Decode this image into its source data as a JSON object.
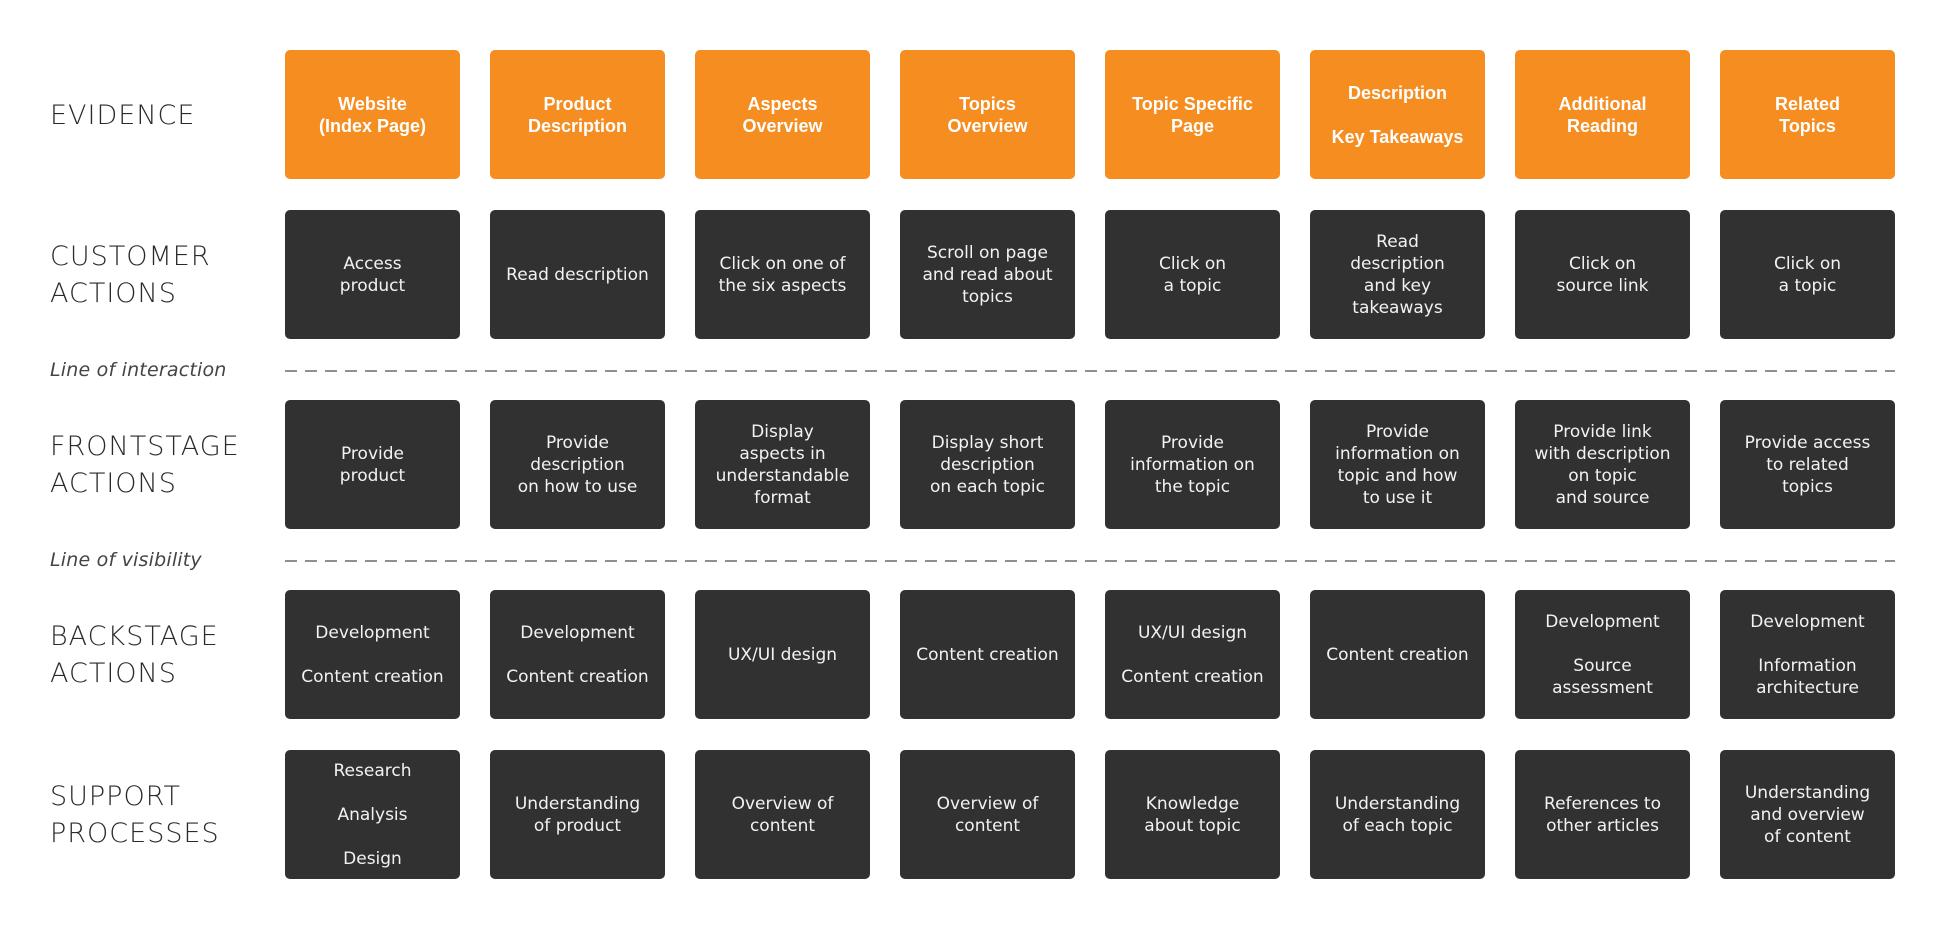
{
  "colors": {
    "evidence_bg": "#f58d21",
    "action_bg": "#313131",
    "line": "#8f8f8f",
    "text_light": "#f2f2f2"
  },
  "rows": [
    {
      "key": "evidence",
      "label": [
        "EVIDENCE"
      ]
    },
    {
      "key": "customer",
      "label": [
        "CUSTOMER",
        "ACTIONS"
      ]
    },
    {
      "key": "frontstage",
      "label": [
        "FRONTSTAGE",
        "ACTIONS"
      ]
    },
    {
      "key": "backstage",
      "label": [
        "BACKSTAGE",
        "ACTIONS"
      ]
    },
    {
      "key": "support",
      "label": [
        "SUPPORT",
        "PROCESSES"
      ]
    }
  ],
  "dividers": {
    "interaction": "Line of interaction",
    "visibility": "Line of visibility"
  },
  "evidence": [
    {
      "lines": [
        "Website",
        "(Index Page)"
      ]
    },
    {
      "lines": [
        "Product",
        "Description"
      ]
    },
    {
      "lines": [
        "Aspects",
        "Overview"
      ]
    },
    {
      "lines": [
        "Topics",
        "Overview"
      ]
    },
    {
      "lines": [
        "Topic Specific",
        "Page"
      ]
    },
    {
      "groups": [
        [
          "Description"
        ],
        [
          "Key Takeaways"
        ]
      ]
    },
    {
      "lines": [
        "Additional",
        "Reading"
      ]
    },
    {
      "lines": [
        "Related",
        "Topics"
      ]
    }
  ],
  "customer": [
    {
      "lines": [
        "Access",
        "product"
      ]
    },
    {
      "lines": [
        "Read description"
      ]
    },
    {
      "lines": [
        "Click on one of",
        "the six aspects"
      ]
    },
    {
      "lines": [
        "Scroll on page",
        "and read about",
        "topics"
      ]
    },
    {
      "lines": [
        "Click on",
        "a topic"
      ]
    },
    {
      "lines": [
        "Read",
        "description",
        "and key",
        "takeaways"
      ]
    },
    {
      "lines": [
        "Click on",
        "source link"
      ]
    },
    {
      "lines": [
        "Click on",
        "a topic"
      ]
    }
  ],
  "frontstage": [
    {
      "lines": [
        "Provide",
        "product"
      ]
    },
    {
      "lines": [
        "Provide",
        "description",
        "on how to use"
      ]
    },
    {
      "lines": [
        "Display",
        "aspects in",
        "understandable",
        "format"
      ]
    },
    {
      "lines": [
        "Display short",
        "description",
        "on each topic"
      ]
    },
    {
      "lines": [
        "Provide",
        "information on",
        "the topic"
      ]
    },
    {
      "lines": [
        "Provide",
        "information on",
        "topic and how",
        "to use it"
      ]
    },
    {
      "lines": [
        "Provide link",
        "with description",
        "on topic",
        "and source"
      ]
    },
    {
      "lines": [
        "Provide access",
        "to related",
        "topics"
      ]
    }
  ],
  "backstage": [
    {
      "groups": [
        [
          "Development"
        ],
        [
          "Content creation"
        ]
      ]
    },
    {
      "groups": [
        [
          "Development"
        ],
        [
          "Content creation"
        ]
      ]
    },
    {
      "lines": [
        "UX/UI design"
      ]
    },
    {
      "lines": [
        "Content creation"
      ]
    },
    {
      "groups": [
        [
          "UX/UI design"
        ],
        [
          "Content creation"
        ]
      ]
    },
    {
      "lines": [
        "Content creation"
      ]
    },
    {
      "groups": [
        [
          "Development"
        ],
        [
          "Source",
          "assessment"
        ]
      ]
    },
    {
      "groups": [
        [
          "Development"
        ],
        [
          "Information",
          "architecture"
        ]
      ]
    }
  ],
  "support": [
    {
      "groups": [
        [
          "Research"
        ],
        [
          "Analysis"
        ],
        [
          "Design"
        ]
      ]
    },
    {
      "lines": [
        "Understanding",
        "of product"
      ]
    },
    {
      "lines": [
        "Overview of",
        "content"
      ]
    },
    {
      "lines": [
        "Overview of",
        "content"
      ]
    },
    {
      "lines": [
        "Knowledge",
        "about topic"
      ]
    },
    {
      "lines": [
        "Understanding",
        "of each topic"
      ]
    },
    {
      "lines": [
        "References to",
        "other articles"
      ]
    },
    {
      "lines": [
        "Understanding",
        "and overview",
        "of content"
      ]
    }
  ]
}
